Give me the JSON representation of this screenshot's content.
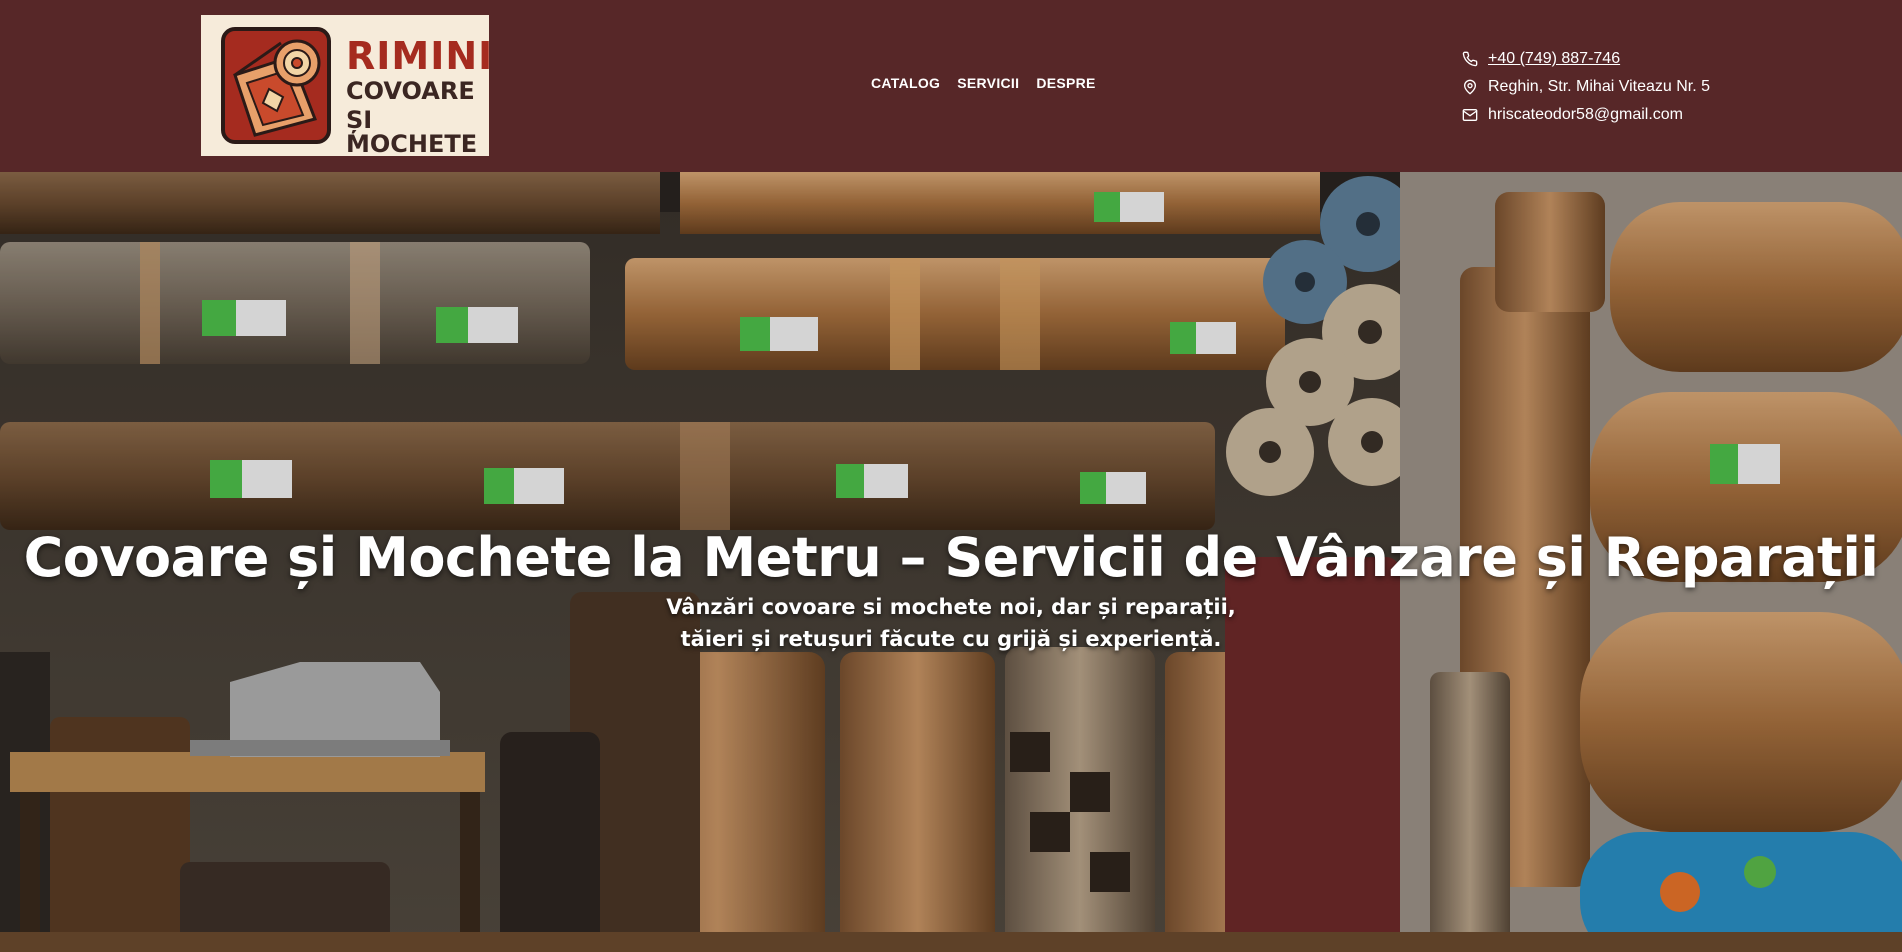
{
  "logo": {
    "line1": "RIMINI",
    "line2": "COVOARE",
    "line3": "ȘI MOCHETE"
  },
  "nav": [
    {
      "label": "CATALOG"
    },
    {
      "label": "SERVICII"
    },
    {
      "label": "DESPRE"
    }
  ],
  "contact": {
    "phone": "+40 (749) 887-746",
    "address": "Reghin, Str. Mihai Viteazu Nr. 5",
    "email": "hriscateodor58@gmail.com"
  },
  "hero": {
    "title": "Covoare și Mochete la Metru – Servicii de Vânzare și Reparații",
    "subtitle": "Vânzări covoare si mochete noi, dar și reparații, tăieri și retușuri făcute cu grijă și experiență."
  },
  "colors": {
    "header_bg": "#572728",
    "logo_bg": "#f6ebda",
    "logo_red": "#a52b1f"
  },
  "icons": [
    "phone-icon",
    "map-pin-icon",
    "mail-icon"
  ]
}
